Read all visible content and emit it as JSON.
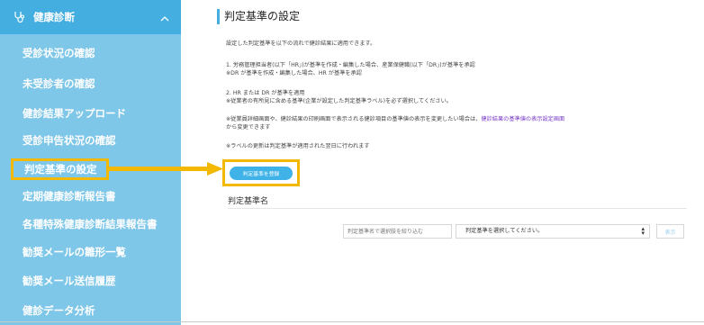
{
  "sidebar": {
    "header": {
      "title": "健康診断"
    },
    "items": [
      {
        "label": "受診状況の確認"
      },
      {
        "label": "未受診者の確認"
      },
      {
        "label": "健診結果アップロード"
      },
      {
        "label": "受診申告状況の確認"
      },
      {
        "label": "判定基準の設定"
      },
      {
        "label": "定期健康診断報告書"
      },
      {
        "label": "各種特殊健康診断結果報告書"
      },
      {
        "label": "勧奨メールの雛形一覧"
      },
      {
        "label": "勧奨メール送信履歴"
      },
      {
        "label": "健診データ分析"
      }
    ],
    "highlight_color": "#f3b800"
  },
  "main": {
    "title": "判定基準の設定",
    "intro": "設定した判定基準を以下の流れで健診結果に適用できます。",
    "step1_line1": "1. 労務管理担当者(以下「HR」)が基準を作成・編集した場合、産業保健職(以下「DR」)が基準を承認",
    "step1_line2": "※DR が基準を作成・編集した場合、HR が基準を承認",
    "step2_line1": "2. HR または DR が基準を適用",
    "step2_line2": "※従業者の有所見に含める基準(企業が設定した判定基準ラベル)を必ず選択してください。",
    "note1_prefix": "※従業員詳細画面や、健診結果の印刷画面で表示される健診項目の基準値の表示を変更したい場合は、",
    "note1_link": "健診結果の基準値の表示設定画面",
    "note1_line2": "から変更できます",
    "note2": "※ラベルの更新は判定基準が適用された翌日に行われます",
    "register_button": "判定基準を登録",
    "section_title": "判定基準名",
    "search_placeholder": "判定基準名で選択肢を絞り込む",
    "select_value": "判定基準を選択してください。",
    "show_button": "表示"
  }
}
